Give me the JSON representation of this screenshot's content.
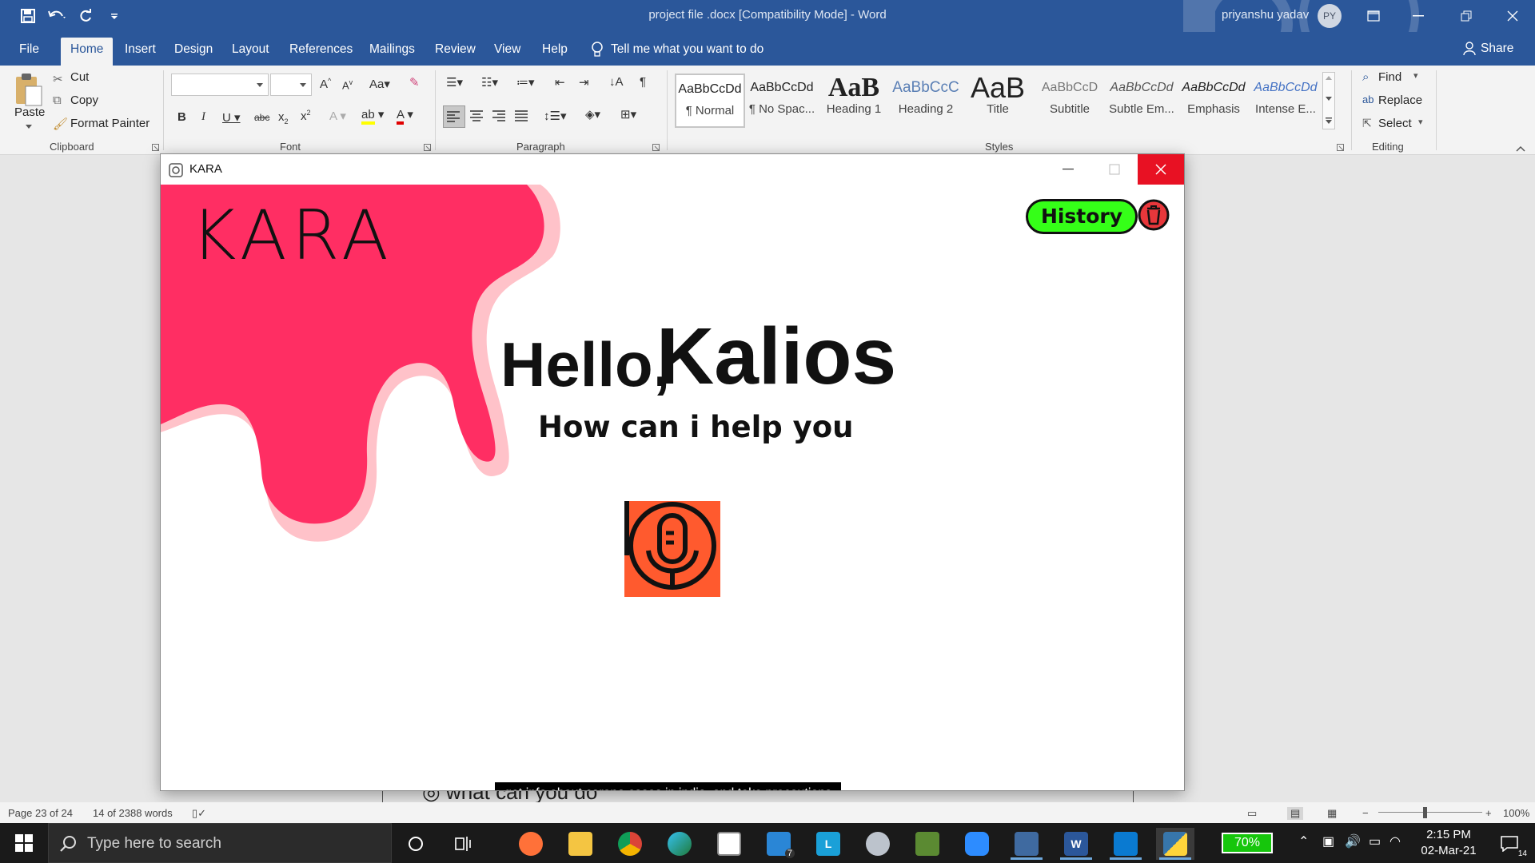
{
  "word": {
    "title": "project file .docx [Compatibility Mode]  -  Word",
    "user_name": "priyanshu yadav",
    "user_initials": "PY",
    "tabs": [
      "File",
      "Home",
      "Insert",
      "Design",
      "Layout",
      "References",
      "Mailings",
      "Review",
      "View",
      "Help"
    ],
    "active_tab": "Home",
    "tell_me": "Tell me what you want to do",
    "share": "Share",
    "clipboard": {
      "paste": "Paste",
      "cut": "Cut",
      "copy": "Copy",
      "format_painter": "Format Painter",
      "label": "Clipboard"
    },
    "font_label": "Font",
    "paragraph_label": "Paragraph",
    "styles": [
      {
        "sample": "AaBbCcDd",
        "name": "¶ Normal"
      },
      {
        "sample": "AaBbCcDd",
        "name": "¶ No Spac..."
      },
      {
        "sample": "AaB",
        "name": "Heading 1"
      },
      {
        "sample": "AaBbCcC",
        "name": "Heading 2"
      },
      {
        "sample": "AaB",
        "name": "Title"
      },
      {
        "sample": "AaBbCcD",
        "name": "Subtitle"
      },
      {
        "sample": "AaBbCcDd",
        "name": "Subtle Em..."
      },
      {
        "sample": "AaBbCcDd",
        "name": "Emphasis"
      },
      {
        "sample": "AaBbCcDd",
        "name": "Intense E..."
      }
    ],
    "styles_label": "Styles",
    "editing": {
      "find": "Find",
      "replace": "Replace",
      "select": "Select",
      "label": "Editing"
    },
    "doc_peek": "what can you do",
    "status": {
      "page": "Page 23 of 24",
      "words": "14 of 2388 words",
      "zoom": "100%"
    }
  },
  "kara": {
    "window_title": "KARA",
    "logo": "KARA",
    "greeting": "Hello,",
    "name": "Kalios",
    "prompt": "How can i help you",
    "history_button": "History",
    "caption": "get info about corona cases in india, and take precautions"
  },
  "taskbar": {
    "search_placeholder": "Type here to search",
    "battery": "70%",
    "mail_badge": "7",
    "time": "2:15 PM",
    "date": "02-Mar-21",
    "notifications": "14"
  }
}
